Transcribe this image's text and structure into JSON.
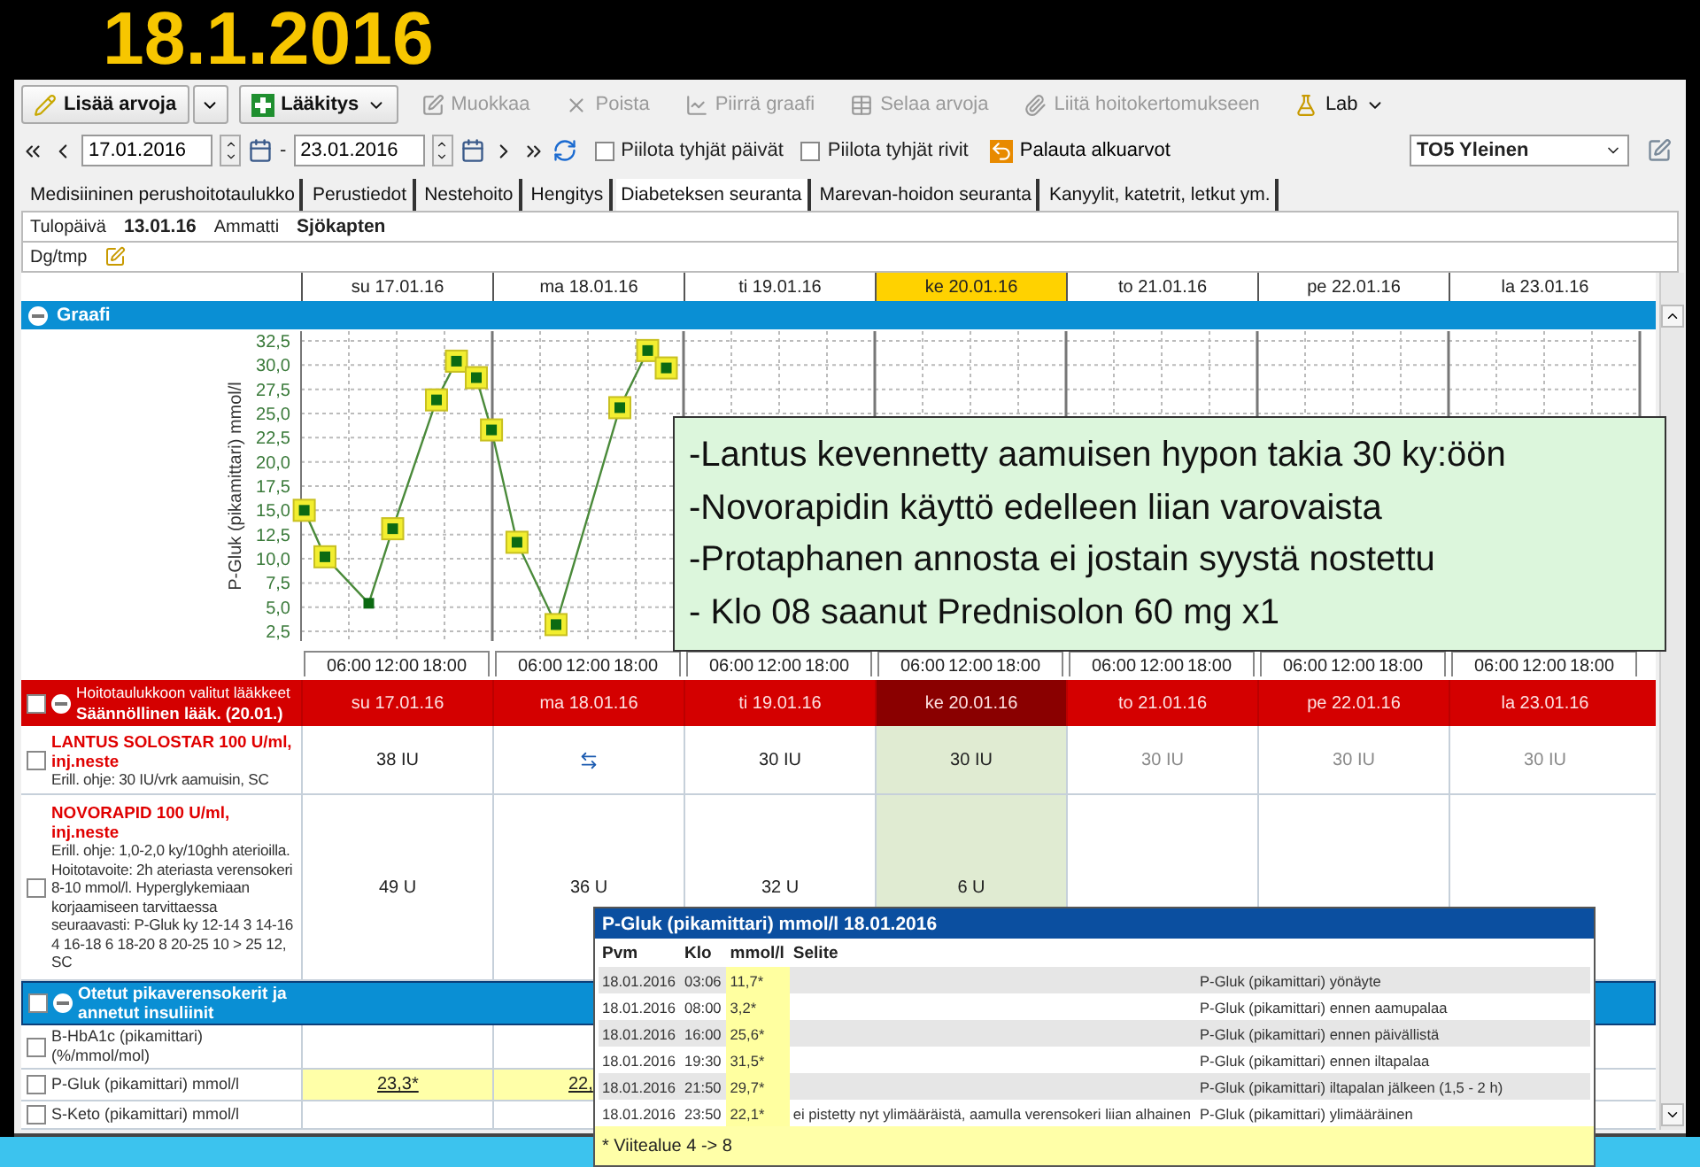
{
  "slide_title": "18.1.2016",
  "toolbar": [
    {
      "label": "Lisää arvoja",
      "kind": "split",
      "disabled": false
    },
    {
      "label": "Lääkitys",
      "kind": "dropdown",
      "disabled": false
    },
    {
      "label": "Muokkaa",
      "kind": "button",
      "disabled": true
    },
    {
      "label": "Poista",
      "kind": "button",
      "disabled": true
    },
    {
      "label": "Piirrä graafi",
      "kind": "button",
      "disabled": true
    },
    {
      "label": "Selaa arvoja",
      "kind": "button",
      "disabled": true
    },
    {
      "label": "Liitä hoitokertomukseen",
      "kind": "button",
      "disabled": true
    },
    {
      "label": "Lab",
      "kind": "dropdown",
      "disabled": false
    }
  ],
  "date_range": {
    "from": "17.01.2016",
    "separator": "-",
    "to": "23.01.2016"
  },
  "options": [
    {
      "label": "Piilota tyhjät päivät",
      "checked": false
    },
    {
      "label": "Piilota tyhjät rivit",
      "checked": false
    }
  ],
  "reset_button": "Palauta alkuarvot",
  "view_select": "TO5 Yleinen",
  "tabs": [
    {
      "label": "Medisiininen perushoitotaulukko",
      "selected": false
    },
    {
      "label": "Perustiedot",
      "selected": false
    },
    {
      "label": "Nestehoito",
      "selected": false
    },
    {
      "label": "Hengitys",
      "selected": false
    },
    {
      "label": "Diabeteksen seuranta",
      "selected": true
    },
    {
      "label": "Marevan-hoidon seuranta",
      "selected": false
    },
    {
      "label": "Kanyylit, katetrit, letkut ym.",
      "selected": false
    }
  ],
  "patient": {
    "arrival_label": "Tulopäivä",
    "arrival_date": "13.01.16",
    "occupation_label": "Ammatti",
    "occupation": "Sjökapten",
    "diagnosis_label": "Dg/tmp"
  },
  "days": [
    {
      "label": "su 17.01.16",
      "selected": false
    },
    {
      "label": "ma 18.01.16",
      "selected": false
    },
    {
      "label": "ti 19.01.16",
      "selected": false
    },
    {
      "label": "ke 20.01.16",
      "selected": true
    },
    {
      "label": "to 21.01.16",
      "selected": false
    },
    {
      "label": "pe 22.01.16",
      "selected": false
    },
    {
      "label": "la 23.01.16",
      "selected": false
    }
  ],
  "graph": {
    "title": "Graafi",
    "expanded": true,
    "chart_data": {
      "type": "line",
      "ylabel": "P-Gluk (pikamittari) mmol/l",
      "grid": true,
      "x": [
        "2016-01-17T00:24",
        "2016-01-17T03:00",
        "2016-01-17T08:30",
        "2016-01-17T11:30",
        "2016-01-17T17:00",
        "2016-01-17T19:30",
        "2016-01-17T22:00",
        "2016-01-17T23:54",
        "2016-01-18T03:06",
        "2016-01-18T08:00",
        "2016-01-18T16:00",
        "2016-01-18T19:30",
        "2016-01-18T21:50"
      ],
      "series": [
        {
          "color": "#4a8a3a",
          "marker": "square",
          "values": [
            15.0,
            10.2,
            5.4,
            13.1,
            26.4,
            30.4,
            28.7,
            23.3,
            11.7,
            3.2,
            25.6,
            31.5,
            29.7
          ]
        }
      ],
      "xlim": [
        "2016-01-17T00:00",
        "2016-01-24T00:00"
      ],
      "ylim": [
        1.5,
        33.5
      ],
      "yticks": [
        {
          "value": 2.5,
          "label": "2,5"
        },
        {
          "value": 5,
          "label": "5,0"
        },
        {
          "value": 7.5,
          "label": "7,5"
        },
        {
          "value": 10,
          "label": "10,0"
        },
        {
          "value": 12.5,
          "label": "12,5"
        },
        {
          "value": 15,
          "label": "15,0"
        },
        {
          "value": 17.5,
          "label": "17,5"
        },
        {
          "value": 20,
          "label": "20,0"
        },
        {
          "value": 22.5,
          "label": "22,5"
        },
        {
          "value": 25,
          "label": "25,0"
        },
        {
          "value": 27.5,
          "label": "27,5"
        },
        {
          "value": 30,
          "label": "30,0"
        },
        {
          "value": 32.5,
          "label": "32,5"
        }
      ],
      "xticks": [
        {
          "value": "2016-01-17T06:00",
          "label": "06:00"
        },
        {
          "value": "2016-01-17T12:00",
          "label": "12:00"
        },
        {
          "value": "2016-01-17T18:00",
          "label": "18:00"
        },
        {
          "value": "2016-01-18T06:00",
          "label": "06:00"
        },
        {
          "value": "2016-01-18T12:00",
          "label": "12:00"
        },
        {
          "value": "2016-01-18T18:00",
          "label": "18:00"
        },
        {
          "value": "2016-01-19T06:00",
          "label": "06:00"
        },
        {
          "value": "2016-01-19T12:00",
          "label": "12:00"
        },
        {
          "value": "2016-01-19T18:00",
          "label": "18:00"
        },
        {
          "value": "2016-01-20T06:00",
          "label": "06:00"
        },
        {
          "value": "2016-01-20T12:00",
          "label": "12:00"
        },
        {
          "value": "2016-01-20T18:00",
          "label": "18:00"
        },
        {
          "value": "2016-01-21T06:00",
          "label": "06:00"
        },
        {
          "value": "2016-01-21T12:00",
          "label": "12:00"
        },
        {
          "value": "2016-01-21T18:00",
          "label": "18:00"
        },
        {
          "value": "2016-01-22T06:00",
          "label": "06:00"
        },
        {
          "value": "2016-01-22T12:00",
          "label": "12:00"
        },
        {
          "value": "2016-01-22T18:00",
          "label": "18:00"
        },
        {
          "value": "2016-01-23T06:00",
          "label": "06:00"
        },
        {
          "value": "2016-01-23T12:00",
          "label": "12:00"
        },
        {
          "value": "2016-01-23T18:00",
          "label": "18:00"
        }
      ]
    }
  },
  "note": [
    "-Lantus kevennetty aamuisen hypon takia 30 ky:öön",
    "-Novorapidin käyttö edelleen liian varovaista",
    "-Protaphanen annosta ei jostain syystä nostettu",
    "- Klo 08 saanut Prednisolon 60 mg x1"
  ],
  "medication": {
    "title": "Hoitotaulukkoon valitut lääkkeet",
    "subtitle": "Säännöllinen lääk. (20.01.)",
    "checked": false,
    "expanded": true,
    "days": [
      {
        "label": "su 17.01.16",
        "selected": false
      },
      {
        "label": "ma 18.01.16",
        "selected": false
      },
      {
        "label": "ti 19.01.16",
        "selected": false
      },
      {
        "label": "ke 20.01.16",
        "selected": true
      },
      {
        "label": "to 21.01.16",
        "selected": false
      },
      {
        "label": "pe 22.01.16",
        "selected": false
      },
      {
        "label": "la 23.01.16",
        "selected": false
      }
    ],
    "rows": [
      {
        "name": "LANTUS SOLOSTAR 100 U/ml, inj.neste",
        "instructions": "Erill. ohje: 30 IU/vrk aamuisin, SC",
        "checked": false,
        "cells": [
          {
            "kind": "given",
            "text": "38 IU"
          },
          {
            "kind": "continue"
          },
          {
            "kind": "given",
            "text": "30 IU"
          },
          {
            "kind": "given",
            "text": "30 IU"
          },
          {
            "kind": "planned",
            "text": "30 IU"
          },
          {
            "kind": "planned",
            "text": "30 IU"
          },
          {
            "kind": "planned",
            "text": "30 IU"
          }
        ]
      },
      {
        "name": "NOVORAPID 100 U/ml, inj.neste",
        "instructions": "Erill. ohje: 1,0-2,0 ky/10ghh aterioilla. Hoitotavoite: 2h ateriasta verensokeri 8-10 mmol/l. Hyperglykemiaan korjaamiseen tarvittaessa seuraavasti: P-Gluk ky 12-14 3 14-16 4 16-18 6 18-20 8 20-25 10 > 25 12, SC",
        "checked": false,
        "cells": [
          {
            "kind": "given",
            "text": "49 U"
          },
          {
            "kind": "given",
            "text": "36 U"
          },
          {
            "kind": "given",
            "text": "32 U"
          },
          {
            "kind": "given",
            "text": "6 U"
          },
          {
            "kind": "none"
          },
          {
            "kind": "none"
          },
          {
            "kind": "none"
          }
        ]
      }
    ]
  },
  "measurements": {
    "title": "Otetut pikaverensokerit ja annetut insuliinit",
    "checked": false,
    "expanded": true,
    "rows": [
      {
        "name": "B-HbA1c (pikamittari) (%/mmol/mol)",
        "checked": false
      },
      {
        "name": "P-Gluk (pikamittari) mmol/l",
        "checked": false,
        "cells": [
          {
            "text": "23,3*",
            "abnormal": true
          },
          {
            "text": "22,",
            "abnormal": true
          }
        ]
      },
      {
        "name": "S-Keto (pikamittari) mmol/l",
        "checked": false
      }
    ]
  },
  "popup": {
    "title": "P-Gluk (pikamittari) mmol/l 18.01.2016",
    "columns": [
      "Pvm",
      "Klo",
      "mmol/l",
      "Selite"
    ],
    "rows": [
      {
        "date": "18.01.2016",
        "time": "03:06",
        "value": "11,7*",
        "abnormal": true,
        "description": "P-Gluk (pikamittari) yönäyte"
      },
      {
        "date": "18.01.2016",
        "time": "08:00",
        "value": "3,2*",
        "abnormal": true,
        "description": "P-Gluk (pikamittari) ennen aamupalaa"
      },
      {
        "date": "18.01.2016",
        "time": "16:00",
        "value": "25,6*",
        "abnormal": true,
        "description": "P-Gluk (pikamittari) ennen päivällistä"
      },
      {
        "date": "18.01.2016",
        "time": "19:30",
        "value": "31,5*",
        "abnormal": true,
        "description": "P-Gluk (pikamittari) ennen iltapalaa"
      },
      {
        "date": "18.01.2016",
        "time": "21:50",
        "value": "29,7*",
        "abnormal": true,
        "description": "P-Gluk (pikamittari) iltapalan jälkeen (1,5 - 2 h)"
      },
      {
        "date": "18.01.2016",
        "time": "23:50",
        "value": "22,1*",
        "abnormal": true,
        "comment": "ei pistetty nyt ylimääräistä, aamulla verensokeri liian alhainen",
        "description": "P-Gluk (pikamittari) ylimääräinen"
      }
    ],
    "footer": "* Viitealue 4 -> 8"
  }
}
